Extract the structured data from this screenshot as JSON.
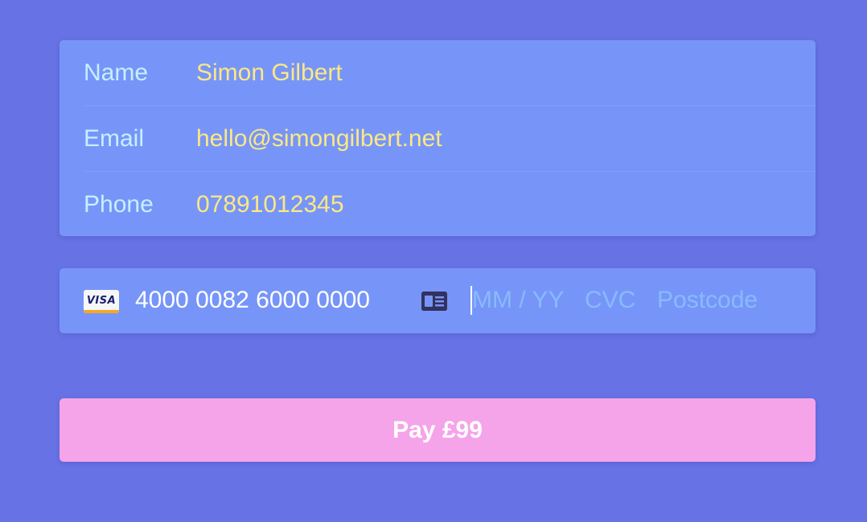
{
  "contact": {
    "name_label": "Name",
    "name_value": "Simon Gilbert",
    "email_label": "Email",
    "email_value": "hello@simongilbert.net",
    "phone_label": "Phone",
    "phone_value": "07891012345"
  },
  "card": {
    "brand": "VISA",
    "brand_icon": "visa-card-icon",
    "number": "4000 0082 6000 0000",
    "id_icon": "id-card-icon",
    "expiry_placeholder": "MM / YY",
    "cvc_placeholder": "CVC",
    "postcode_placeholder": "Postcode"
  },
  "pay": {
    "label": "Pay £99"
  },
  "colors": {
    "background": "#6772e5",
    "panel": "#7795f8",
    "label": "#c4f0ff",
    "value": "#fce883",
    "placeholder": "#87bbfd",
    "button": "#f5a4e9"
  }
}
